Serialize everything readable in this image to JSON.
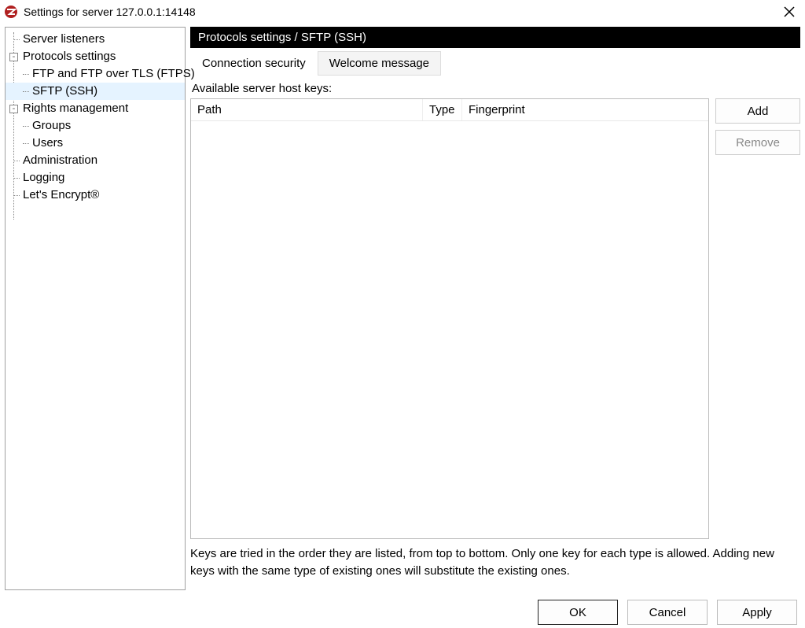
{
  "window": {
    "title": "Settings for server 127.0.0.1:14148"
  },
  "tree": {
    "items": [
      {
        "label": "Server listeners"
      },
      {
        "label": "Protocols settings"
      },
      {
        "label": "FTP and FTP over TLS (FTPS)"
      },
      {
        "label": "SFTP (SSH)"
      },
      {
        "label": "Rights management"
      },
      {
        "label": "Groups"
      },
      {
        "label": "Users"
      },
      {
        "label": "Administration"
      },
      {
        "label": "Logging"
      },
      {
        "label": "Let's Encrypt®"
      }
    ],
    "expander": "-"
  },
  "panel": {
    "header": "Protocols settings / SFTP (SSH)",
    "tabs": {
      "active": "Connection security",
      "inactive": "Welcome message"
    },
    "section_label": "Available server host keys:",
    "columns": {
      "path": "Path",
      "type": "Type",
      "fingerprint": "Fingerprint"
    },
    "buttons": {
      "add": "Add",
      "remove": "Remove"
    },
    "hint": "Keys are tried in the order they are listed, from top to bottom. Only one key for each type is allowed. Adding new keys with the same type of existing ones will substitute the existing ones."
  },
  "footer": {
    "ok": "OK",
    "cancel": "Cancel",
    "apply": "Apply"
  }
}
